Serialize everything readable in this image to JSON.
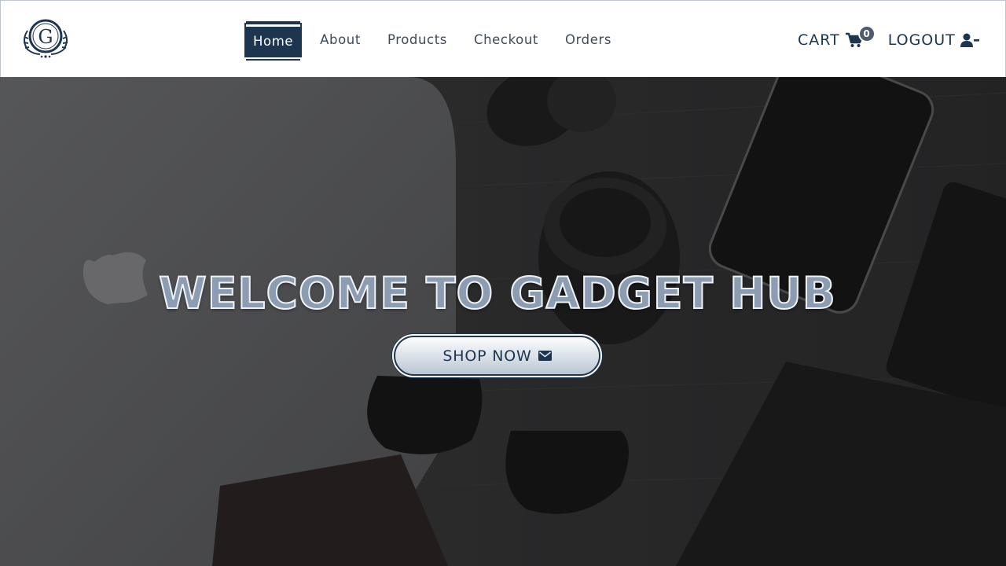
{
  "header": {
    "logo_letter": "G",
    "nav": [
      {
        "label": "Home",
        "active": true
      },
      {
        "label": "About",
        "active": false
      },
      {
        "label": "Products",
        "active": false
      },
      {
        "label": "Checkout",
        "active": false
      },
      {
        "label": "Orders",
        "active": false
      }
    ],
    "cart_label": "CART",
    "cart_count": "0",
    "cart_icon": "shopping-cart-icon",
    "logout_label": "LOGOUT",
    "logout_icon": "user-minus-icon"
  },
  "hero": {
    "title": "WELCOME TO GADGET HUB",
    "button_label": "SHOP NOW",
    "button_icon": "envelope-icon",
    "background": "desk-with-gadgets-photo"
  },
  "colors": {
    "brand": "#1e3550",
    "nav_text": "#3e4a58",
    "badge": "#4d5b6c",
    "header_bg": "#ffffff"
  }
}
